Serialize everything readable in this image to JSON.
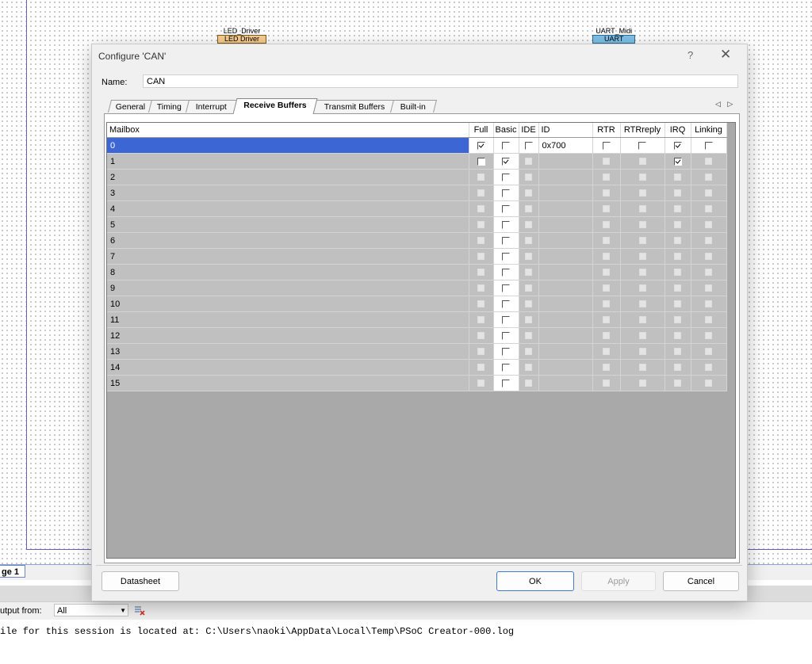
{
  "schematic": {
    "components": [
      {
        "instance": "LED_Driver",
        "type": "LED Driver"
      },
      {
        "instance": "UART_Midi",
        "type": "UART"
      }
    ]
  },
  "ide": {
    "page_tab": "ge 1",
    "output_from_label": "utput from:",
    "output_from_value": "All",
    "log_line": "ile for this session is located at: C:\\Users\\naoki\\AppData\\Local\\Temp\\PSoC Creator-000.log"
  },
  "dialog": {
    "title": "Configure 'CAN'",
    "help": "?",
    "close": "✕",
    "name_label": "Name:",
    "name_value": "CAN",
    "tabs": [
      "General",
      "Timing",
      "Interrupt",
      "Receive Buffers",
      "Transmit Buffers",
      "Built-in"
    ],
    "active_tab": "Receive Buffers",
    "tab_scroll": "◁ ▷",
    "columns": [
      "Mailbox",
      "Full",
      "Basic",
      "IDE",
      "ID",
      "RTR",
      "RTRreply",
      "IRQ",
      "Linking"
    ],
    "rows": [
      {
        "mailbox": "0",
        "full": true,
        "basic": false,
        "ide": false,
        "id": "0x700",
        "rtr": false,
        "rtrreply": false,
        "irq": true,
        "linking": false,
        "selected": true
      },
      {
        "mailbox": "1",
        "full": false,
        "basic": true,
        "ide": false,
        "id": "",
        "rtr": false,
        "rtrreply": false,
        "irq": true,
        "linking": false
      },
      {
        "mailbox": "2",
        "full": false,
        "basic": false,
        "ide": false,
        "id": "",
        "rtr": false,
        "rtrreply": false,
        "irq": false,
        "linking": false
      },
      {
        "mailbox": "3",
        "full": false,
        "basic": false,
        "ide": false,
        "id": "",
        "rtr": false,
        "rtrreply": false,
        "irq": false,
        "linking": false
      },
      {
        "mailbox": "4",
        "full": false,
        "basic": false,
        "ide": false,
        "id": "",
        "rtr": false,
        "rtrreply": false,
        "irq": false,
        "linking": false
      },
      {
        "mailbox": "5",
        "full": false,
        "basic": false,
        "ide": false,
        "id": "",
        "rtr": false,
        "rtrreply": false,
        "irq": false,
        "linking": false
      },
      {
        "mailbox": "6",
        "full": false,
        "basic": false,
        "ide": false,
        "id": "",
        "rtr": false,
        "rtrreply": false,
        "irq": false,
        "linking": false
      },
      {
        "mailbox": "7",
        "full": false,
        "basic": false,
        "ide": false,
        "id": "",
        "rtr": false,
        "rtrreply": false,
        "irq": false,
        "linking": false
      },
      {
        "mailbox": "8",
        "full": false,
        "basic": false,
        "ide": false,
        "id": "",
        "rtr": false,
        "rtrreply": false,
        "irq": false,
        "linking": false
      },
      {
        "mailbox": "9",
        "full": false,
        "basic": false,
        "ide": false,
        "id": "",
        "rtr": false,
        "rtrreply": false,
        "irq": false,
        "linking": false
      },
      {
        "mailbox": "10",
        "full": false,
        "basic": false,
        "ide": false,
        "id": "",
        "rtr": false,
        "rtrreply": false,
        "irq": false,
        "linking": false
      },
      {
        "mailbox": "11",
        "full": false,
        "basic": false,
        "ide": false,
        "id": "",
        "rtr": false,
        "rtrreply": false,
        "irq": false,
        "linking": false
      },
      {
        "mailbox": "12",
        "full": false,
        "basic": false,
        "ide": false,
        "id": "",
        "rtr": false,
        "rtrreply": false,
        "irq": false,
        "linking": false
      },
      {
        "mailbox": "13",
        "full": false,
        "basic": false,
        "ide": false,
        "id": "",
        "rtr": false,
        "rtrreply": false,
        "irq": false,
        "linking": false
      },
      {
        "mailbox": "14",
        "full": false,
        "basic": false,
        "ide": false,
        "id": "",
        "rtr": false,
        "rtrreply": false,
        "irq": false,
        "linking": false
      },
      {
        "mailbox": "15",
        "full": false,
        "basic": false,
        "ide": false,
        "id": "",
        "rtr": false,
        "rtrreply": false,
        "irq": false,
        "linking": false
      }
    ],
    "buttons": {
      "datasheet": "Datasheet",
      "ok": "OK",
      "apply": "Apply",
      "cancel": "Cancel"
    },
    "colors": {
      "selection": "#3c66d3",
      "grid_bg": "#a9a9a9",
      "disabled_cell": "#c0c0c0"
    }
  }
}
